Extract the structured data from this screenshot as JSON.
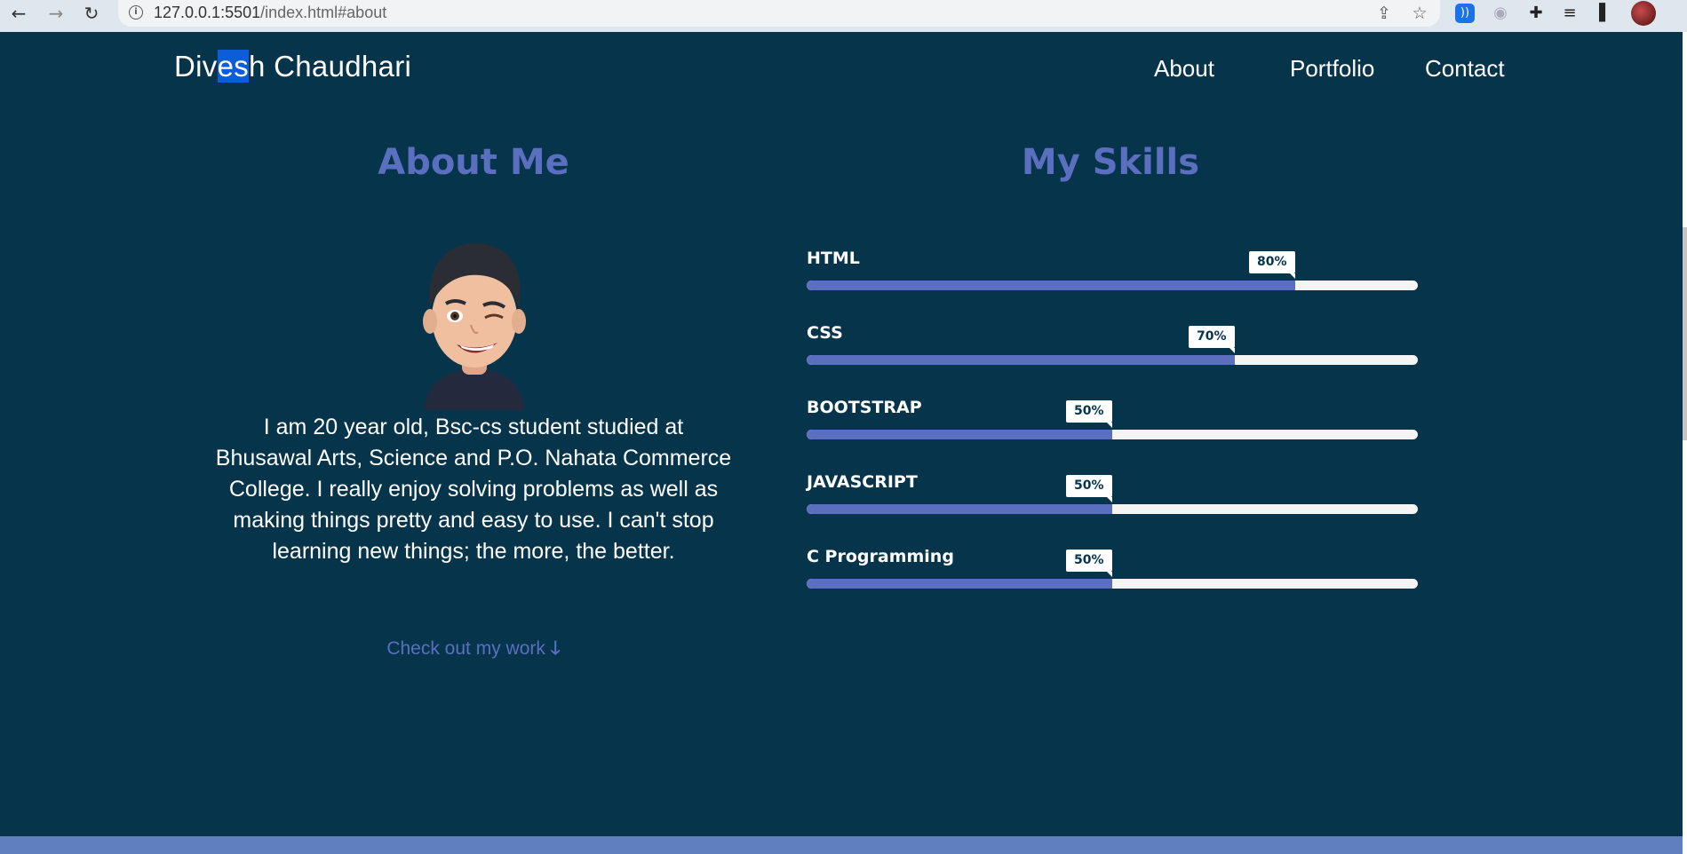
{
  "browser": {
    "url_host": "127.0.0.1:5501",
    "url_path": "/index.html#about",
    "back_icon": "←",
    "forward_icon": "→",
    "reload_icon": "↻",
    "info_icon": "i",
    "share_icon": "⇪",
    "bookmark_icon": "☆",
    "extensions_icon": "✚",
    "media_icon": "≡",
    "sidepanel_icon": "▌",
    "ext_blue_icon": "))",
    "ext_grey_icon": "◉"
  },
  "brand": {
    "part1": "Div",
    "part2": "es",
    "part3": "h Chaudhari"
  },
  "nav": {
    "about": "About",
    "portfolio": "Portfolio",
    "contact": "Contact"
  },
  "about": {
    "title": "About Me",
    "text": "I am 20 year old, Bsc-cs student studied at Bhusawal Arts, Science and P.O. Nahata Commerce College. I really enjoy solving problems as well as making things pretty and easy to use. I can't stop learning new things; the more, the better.",
    "cta_label": "Check out my work",
    "cta_arrow": "🡓"
  },
  "skills": {
    "title": "My Skills",
    "items": [
      {
        "name": "HTML",
        "percent": 80,
        "badge": "80%"
      },
      {
        "name": "CSS",
        "percent": 70,
        "badge": "70%"
      },
      {
        "name": "BOOTSTRAP",
        "percent": 50,
        "badge": "50%"
      },
      {
        "name": "JAVASCRIPT",
        "percent": 50,
        "badge": "50%"
      },
      {
        "name": "C Programming",
        "percent": 50,
        "badge": "50%"
      }
    ]
  },
  "colors": {
    "background": "#06344a",
    "accent": "#5a6fc0",
    "footer": "#5f7fbe"
  }
}
